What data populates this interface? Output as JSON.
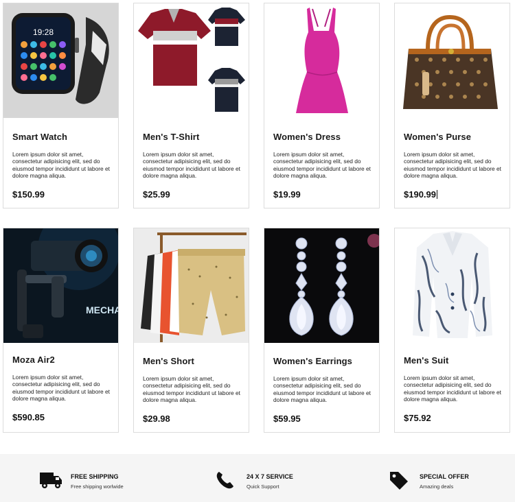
{
  "products": [
    {
      "name": "Smart Watch",
      "description": "Lorem ipsum dolor sit amet, consectetur adipisicing elit, sed do eiusmod tempor incididunt ut labore et dolore magna aliqua.",
      "price": "$150.99"
    },
    {
      "name": "Men's T-Shirt",
      "description": "Lorem ipsum dolor sit amet, consectetur adipisicing elit, sed do eiusmod tempor incididunt ut labore et dolore magna aliqua.",
      "price": "$25.99"
    },
    {
      "name": "Women's Dress",
      "description": "Lorem ipsum dolor sit amet, consectetur adipisicing elit, sed do eiusmod tempor incididunt ut labore et dolore magna aliqua.",
      "price": "$19.99"
    },
    {
      "name": "Women's Purse",
      "description": "Lorem ipsum dolor sit amet, consectetur adipisicing elit, sed do eiusmod tempor incididunt ut labore et dolore magna aliqua.",
      "price": "$190.99"
    },
    {
      "name": "Moza Air2",
      "description": "Lorem ipsum dolor sit amet, consectetur adipisicing elit, sed do eiusmod tempor incididunt ut labore et dolore magna aliqua.",
      "price": "$590.85",
      "image_text": "MECHA ZOOM"
    },
    {
      "name": "Men's Short",
      "description": "Lorem ipsum dolor sit amet, consectetur adipisicing elit, sed do eiusmod tempor incididunt ut labore et dolore magna aliqua.",
      "price": "$29.98"
    },
    {
      "name": "Women's Earrings",
      "description": "Lorem ipsum dolor sit amet, consectetur adipisicing elit, sed do eiusmod tempor incididunt ut labore et dolore magna aliqua.",
      "price": "$59.95"
    },
    {
      "name": "Men's Suit",
      "description": "Lorem ipsum dolor sit amet, consectetur adipisicing elit, sed do eiusmod tempor incididunt ut labore et dolore magna aliqua.",
      "price": "$75.92"
    }
  ],
  "watch_screen": {
    "time": "19:28"
  },
  "features": [
    {
      "title": "FREE SHIPPING",
      "subtitle": "Free shipping worlwide",
      "icon": "truck-icon"
    },
    {
      "title": "24 X 7 SERVICE",
      "subtitle": "Quick Support",
      "icon": "phone-icon"
    },
    {
      "title": "SPECIAL OFFER",
      "subtitle": "Amazing deals",
      "icon": "tag-icon"
    }
  ]
}
